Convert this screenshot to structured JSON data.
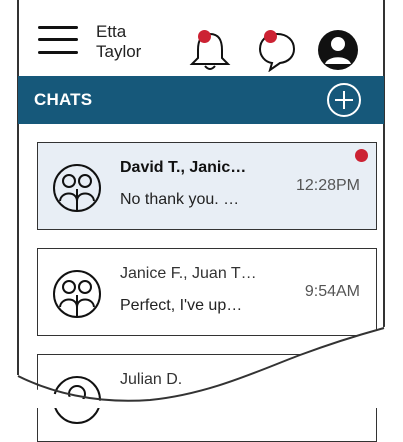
{
  "header": {
    "user_first": "Etta",
    "user_last": "Taylor",
    "bell_icon": "bell-icon",
    "chat_icon": "chat-bubble-icon",
    "account_icon": "account-circle-icon",
    "menu_icon": "hamburger-menu-icon"
  },
  "chats_bar": {
    "title": "CHATS",
    "add_icon": "plus-circle-icon"
  },
  "chats": [
    {
      "names": "David T., Janic…",
      "preview": "No thank you. …",
      "time": "12:28PM",
      "unread": true
    },
    {
      "names": "Janice F., Juan T…",
      "preview": "Perfect, I've up…",
      "time": "9:54AM",
      "unread": false
    },
    {
      "names": "Julian D.",
      "preview": "",
      "time": "",
      "unread": false
    }
  ],
  "colors": {
    "brand": "#16587a",
    "notification": "#cc2233",
    "unread_bg": "#e8eef5"
  }
}
